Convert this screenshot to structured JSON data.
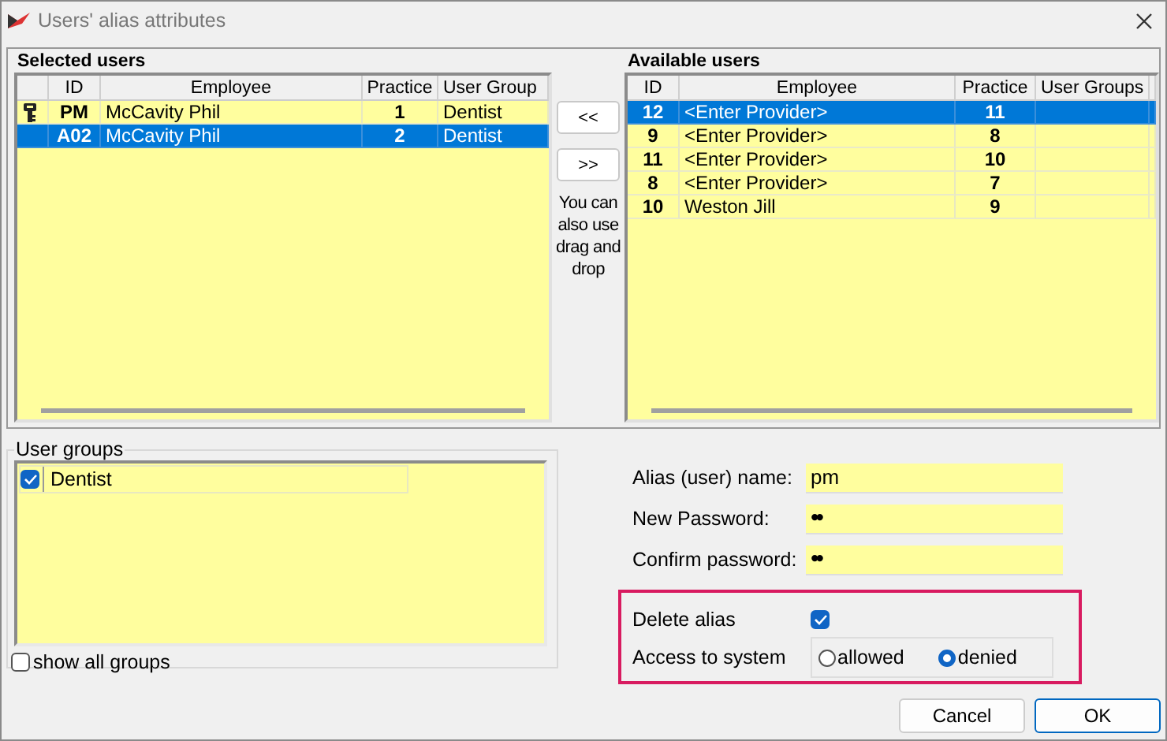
{
  "window": {
    "title": "Users' alias attributes"
  },
  "selected_users": {
    "label": "Selected users",
    "columns": [
      "ID",
      "Employee",
      "Practice",
      "User Group"
    ],
    "rows": [
      {
        "marked": true,
        "id": "PM",
        "employee": "McCavity Phil",
        "practice": "1",
        "group": "Dentist",
        "selected": false
      },
      {
        "marked": false,
        "id": "A02",
        "employee": "McCavity Phil",
        "practice": "2",
        "group": "Dentist",
        "selected": true
      }
    ]
  },
  "move_buttons": [
    "<<",
    ">>"
  ],
  "hint": "You can also use drag and drop",
  "available_users": {
    "label": "Available users",
    "columns": [
      "ID",
      "Employee",
      "Practice",
      "User Groups"
    ],
    "rows": [
      {
        "id": "12",
        "employee": "<Enter Provider>",
        "practice": "11",
        "group": "",
        "selected": true
      },
      {
        "id": "9",
        "employee": "<Enter Provider>",
        "practice": "8",
        "group": "",
        "selected": false
      },
      {
        "id": "11",
        "employee": "<Enter Provider>",
        "practice": "10",
        "group": "",
        "selected": false
      },
      {
        "id": "8",
        "employee": "<Enter Provider>",
        "practice": "7",
        "group": "",
        "selected": false
      },
      {
        "id": "10",
        "employee": "Weston Jill",
        "practice": "9",
        "group": "",
        "selected": false
      }
    ]
  },
  "user_groups": {
    "label": "User groups",
    "items": [
      {
        "label": "Dentist",
        "checked": true
      }
    ],
    "show_all": {
      "label": "show all groups",
      "checked": false
    }
  },
  "fields": [
    {
      "label": "Alias (user) name:",
      "value": "pm"
    },
    {
      "label": "New Password:",
      "value": "••"
    },
    {
      "label": "Confirm password:",
      "value": "••"
    }
  ],
  "delete_alias": {
    "label": "Delete alias",
    "checked": true
  },
  "access": {
    "label": "Access to system",
    "options": [
      {
        "label": "allowed",
        "selected": false
      },
      {
        "label": "denied",
        "selected": true
      }
    ]
  },
  "buttons": [
    "Cancel",
    "OK"
  ]
}
